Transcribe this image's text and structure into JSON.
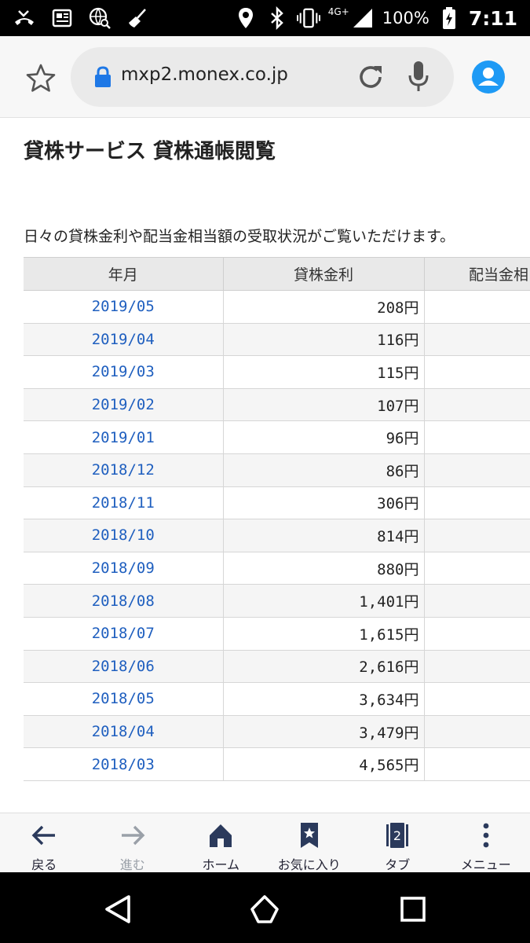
{
  "status_bar": {
    "network": "4G+",
    "battery": "100%",
    "time": "7:11",
    "icons": [
      "missed-call-icon",
      "news-icon",
      "browser-search-icon",
      "broom-icon",
      "location-icon",
      "bluetooth-icon",
      "vibrate-icon",
      "signal-icon",
      "battery-charging-icon"
    ]
  },
  "browser": {
    "url": "mxp2.monex.co.jp"
  },
  "page": {
    "title": "貸株サービス 貸株通帳閲覧",
    "description": "日々の貸株金利や配当金相当額の受取状況がご覧いただけます。"
  },
  "table": {
    "headers": [
      "年月",
      "貸株金利",
      "配当金相"
    ],
    "rows": [
      {
        "month": "2019/05",
        "fee": "208円",
        "dividend": ""
      },
      {
        "month": "2019/04",
        "fee": "116円",
        "dividend": ""
      },
      {
        "month": "2019/03",
        "fee": "115円",
        "dividend": ""
      },
      {
        "month": "2019/02",
        "fee": "107円",
        "dividend": ""
      },
      {
        "month": "2019/01",
        "fee": "96円",
        "dividend": ""
      },
      {
        "month": "2018/12",
        "fee": "86円",
        "dividend": ""
      },
      {
        "month": "2018/11",
        "fee": "306円",
        "dividend": ""
      },
      {
        "month": "2018/10",
        "fee": "814円",
        "dividend": ""
      },
      {
        "month": "2018/09",
        "fee": "880円",
        "dividend": ""
      },
      {
        "month": "2018/08",
        "fee": "1,401円",
        "dividend": ""
      },
      {
        "month": "2018/07",
        "fee": "1,615円",
        "dividend": ""
      },
      {
        "month": "2018/06",
        "fee": "2,616円",
        "dividend": ""
      },
      {
        "month": "2018/05",
        "fee": "3,634円",
        "dividend": ""
      },
      {
        "month": "2018/04",
        "fee": "3,479円",
        "dividend": ""
      },
      {
        "month": "2018/03",
        "fee": "4,565円",
        "dividend": ""
      }
    ]
  },
  "bottom_nav": {
    "back": "戻る",
    "forward": "進む",
    "home": "ホーム",
    "bookmarks": "お気に入り",
    "tabs": "タブ",
    "tab_count": "2",
    "menu": "メニュー"
  },
  "colors": {
    "link": "#1f5fbf",
    "accent": "#1e9af5",
    "nav_icon": "#2b3a5c"
  }
}
